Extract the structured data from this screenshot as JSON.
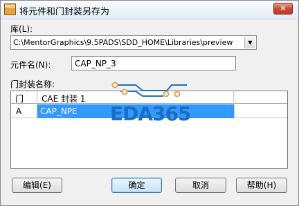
{
  "window": {
    "title": "将元件和门封装另存为",
    "app_icon_text": "PADS",
    "close_glyph": "✕"
  },
  "library": {
    "label": "库(L):",
    "value": "C:\\MentorGraphics\\9.5PADS\\SDD_HOME\\Libraries\\preview"
  },
  "part_name": {
    "label": "元件名(N):",
    "value": "CAP_NP_3"
  },
  "gate_decal": {
    "label": "门封装名称:",
    "columns": [
      "门",
      "CAE 封装 1"
    ],
    "rows": [
      {
        "gate": "A",
        "decal": "CAP_NPE",
        "selected": true
      }
    ]
  },
  "buttons": {
    "edit": "编辑(E)",
    "ok": "确定",
    "cancel": "取消",
    "help": "帮助(H)"
  },
  "watermark": {
    "text": "EDA365",
    "color": "#1d6ec2",
    "accent": "#e8a33a"
  },
  "colors": {
    "selection": "#3399ff",
    "dialog_bg": "#f0f0f0"
  }
}
